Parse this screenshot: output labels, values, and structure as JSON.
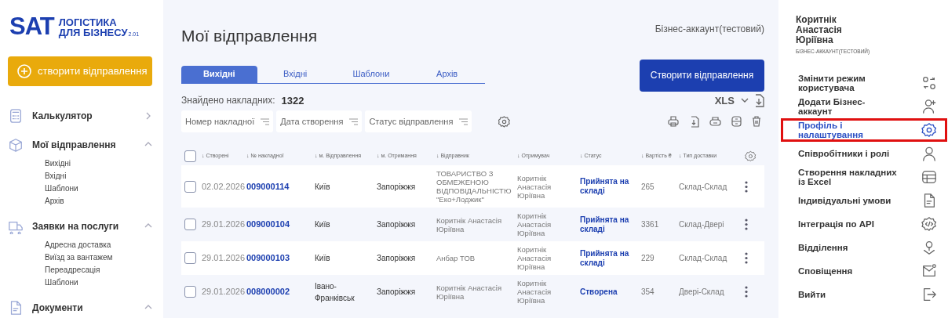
{
  "logo": {
    "mark": "SAT",
    "line1": "ЛОГІСТИКА",
    "line2": "ДЛЯ БІЗНЕСУ",
    "version": "2.01"
  },
  "sidebar": {
    "create_button": "створити відправлення",
    "items": [
      {
        "label": "Калькулятор",
        "expanded": false
      },
      {
        "label": "Мої відправлення",
        "expanded": true,
        "children": [
          {
            "label": "Вихідні"
          },
          {
            "label": "Вхідні"
          },
          {
            "label": "Шаблони"
          },
          {
            "label": "Архів"
          }
        ]
      },
      {
        "label": "Заявки на послуги",
        "expanded": true,
        "children": [
          {
            "label": "Адресна доставка"
          },
          {
            "label": "Виїзд за вантажем"
          },
          {
            "label": "Переадресація"
          },
          {
            "label": "Шаблони"
          }
        ]
      },
      {
        "label": "Документи",
        "expanded": true
      }
    ]
  },
  "main": {
    "title": "Мої відправлення",
    "account_label": "Бізнес-аккаунт(тестовий)",
    "tabs": [
      {
        "label": "Вихідні",
        "selected": true
      },
      {
        "label": "Вхідні",
        "selected": false
      },
      {
        "label": "Шаблони",
        "selected": false
      },
      {
        "label": "Архів",
        "selected": false
      }
    ],
    "create_button": "Створити відправлення",
    "select_all_checked": false,
    "found_label": "Знайдено накладних:",
    "found_count": "1322",
    "export_format": "XLS",
    "filters": [
      "Номер накладної",
      "Дата створення",
      "Статус відправлення"
    ],
    "columns": [
      "↓ Створені",
      "↓ № накладної",
      "↓ м. Відправлення",
      "↓ м. Отримання",
      "↓ Відправник",
      "↓ Отримувач",
      "↓ Статус",
      "↓ Вартість ₴",
      "↓ Тип доставки"
    ],
    "rows": [
      {
        "checked": false,
        "created": "02.02.2026",
        "number": "009000114",
        "from": "Київ",
        "to": "Запоріжжя",
        "sender": "ТОВАРИСТВО З ОБМЕЖЕНОЮ ВІДПОВІДАЛЬНІСТЮ \"Еко+Лоджик\"",
        "recipient": "Коритнік Анастасія Юріївна",
        "status": "Прийнята на складі",
        "cost": "265",
        "delivery": "Склад-Склад"
      },
      {
        "checked": false,
        "created": "29.01.2026",
        "number": "009000104",
        "from": "Київ",
        "to": "Запоріжжя",
        "sender": "Коритнік Анастасія Юріївна",
        "recipient": "Коритнік Анастасія Юріївна",
        "status": "Прийнята на складі",
        "cost": "3361",
        "delivery": "Склад-Двері"
      },
      {
        "checked": false,
        "created": "29.01.2026",
        "number": "009000103",
        "from": "Київ",
        "to": "Запоріжжя",
        "sender": "Анбар ТОВ",
        "recipient": "Коритнік Анастасія Юріївна",
        "status": "Прийнята на складі",
        "cost": "229",
        "delivery": "Склад-Склад"
      },
      {
        "checked": false,
        "created": "29.01.2026",
        "number": "008000002",
        "from": "Івано-Франківськ",
        "to": "Запоріжжя",
        "sender": "Коритнік Анастасія Юріївна",
        "recipient": "Коритнік Анастасія Юріївна",
        "status": "Створена",
        "cost": "354",
        "delivery": "Двері-Склад"
      }
    ]
  },
  "account_panel": {
    "user_name": "Коритнік Анастасія Юріївна",
    "account_type": "БІЗНЕС-АККАУНТ(ТЕСТОВИЙ)",
    "items": [
      {
        "label": "Змінити режим користувача",
        "selected": false
      },
      {
        "label": "Додати Бізнес-аккаунт",
        "selected": false
      },
      {
        "label": "Профіль і налаштування",
        "selected": true
      },
      {
        "label": "Співробітники і ролі",
        "selected": false
      },
      {
        "label": "Створення накладних із Excel",
        "selected": false
      },
      {
        "label": "Індивідуальні умови",
        "selected": false
      },
      {
        "label": "Інтеграція по API",
        "selected": false
      },
      {
        "label": "Відділення",
        "selected": false
      },
      {
        "label": "Сповіщення",
        "selected": false
      },
      {
        "label": "Вийти",
        "selected": false
      }
    ]
  }
}
